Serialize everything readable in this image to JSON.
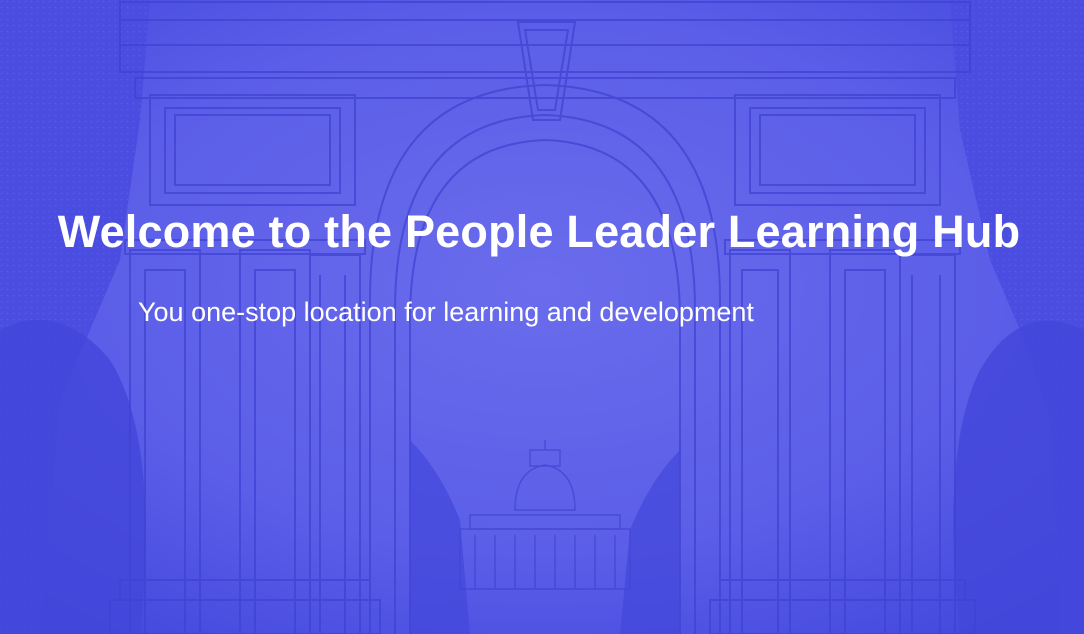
{
  "hero": {
    "title": "Welcome to the People Leader Learning Hub",
    "subtitle": "You one-stop location for learning and development",
    "background_image": "arch-building-illustration",
    "overlay_color": "#5256e6",
    "text_color": "#ffffff"
  }
}
